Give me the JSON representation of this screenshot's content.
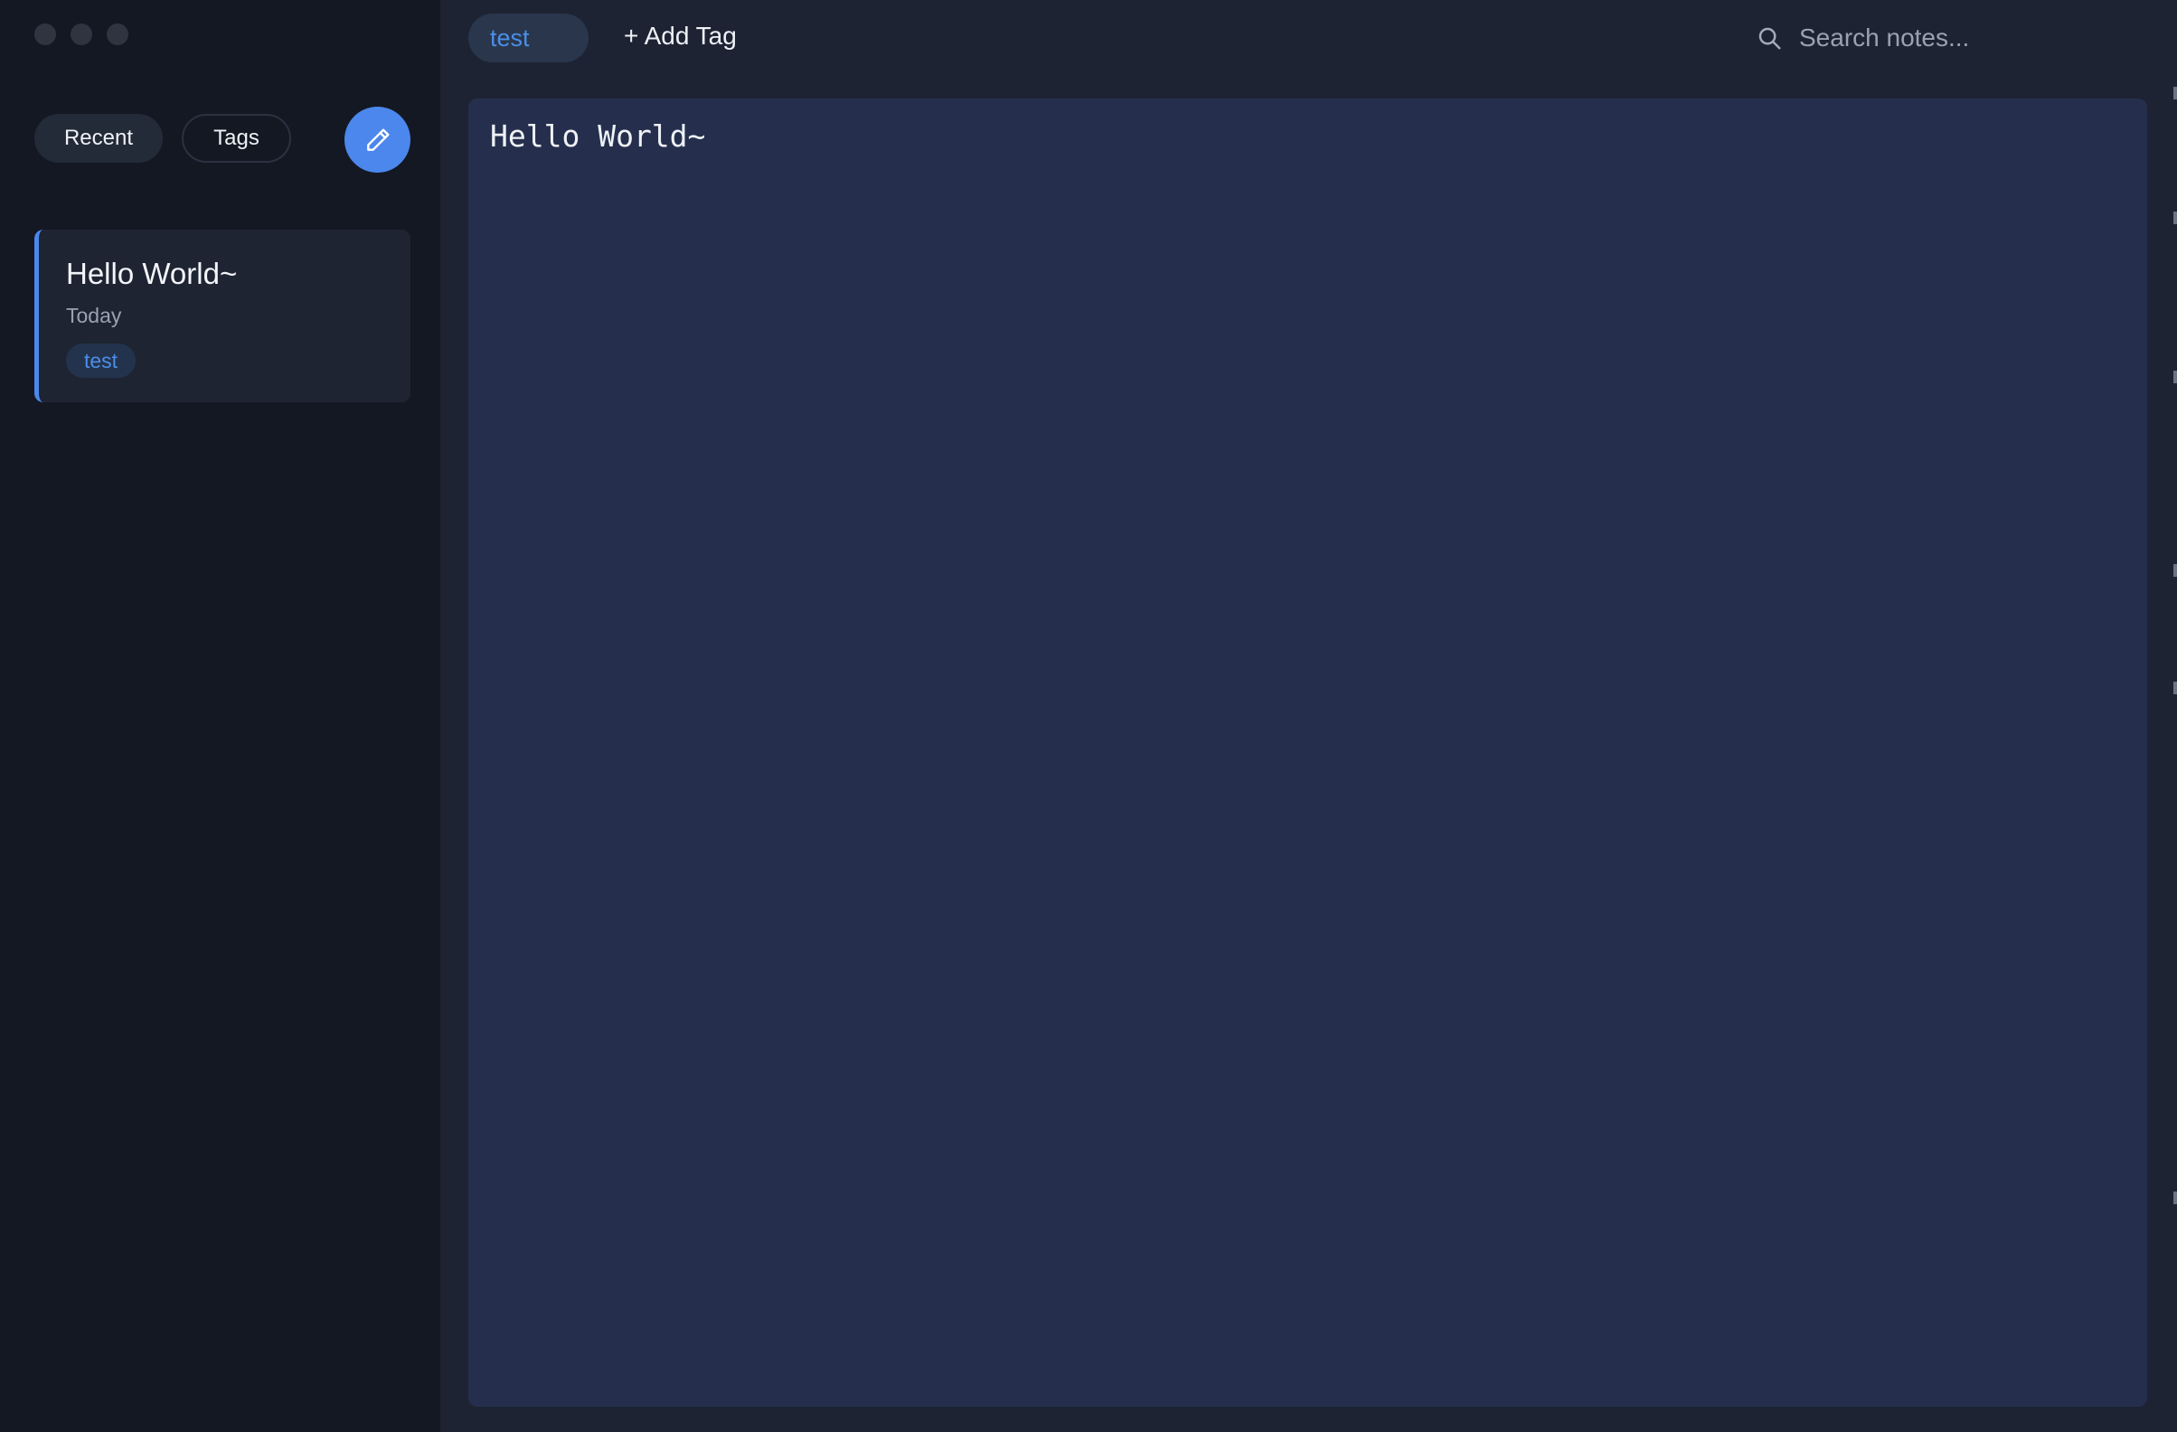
{
  "window": {
    "traffic_lights": [
      "close",
      "minimize",
      "zoom"
    ]
  },
  "sidebar": {
    "filters": {
      "recent_label": "Recent",
      "tags_label": "Tags"
    },
    "compose_icon": "pencil-icon",
    "notes": [
      {
        "title": "Hello World~",
        "date": "Today",
        "tags": [
          "test"
        ]
      }
    ]
  },
  "toolbar": {
    "active_tag": "test",
    "add_tag_label": "+ Add Tag",
    "search": {
      "icon": "search-icon",
      "placeholder": "Search notes..."
    }
  },
  "editor": {
    "content": "Hello World~"
  },
  "colors": {
    "accent": "#4b87ec",
    "sidebar_bg": "#141823",
    "main_bg": "#1d2333",
    "editor_bg": "#252f4d",
    "tag_text": "#4b8ee6"
  }
}
